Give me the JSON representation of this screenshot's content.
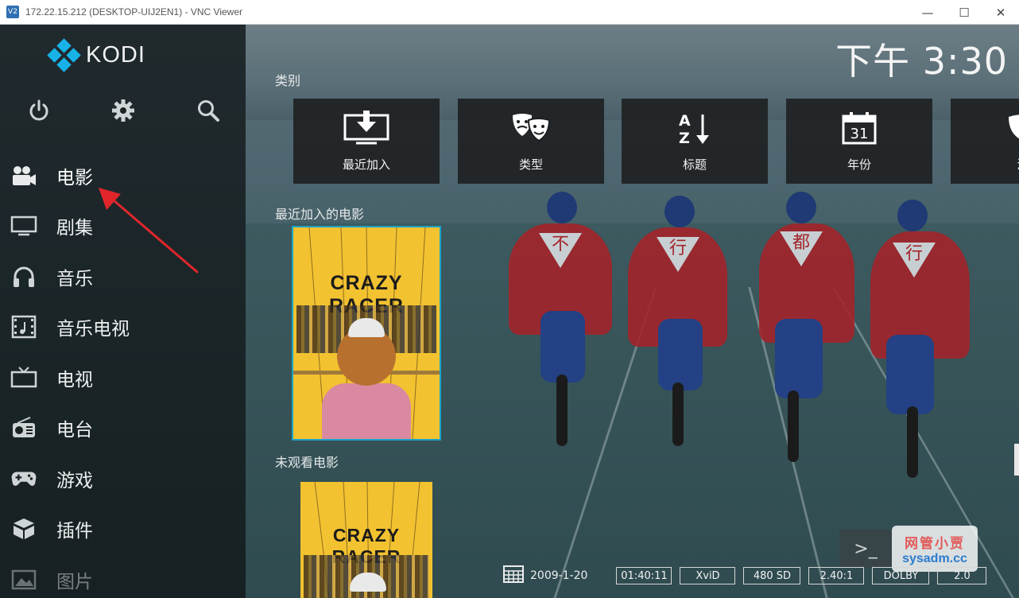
{
  "window": {
    "title": "172.22.15.212 (DESKTOP-UIJ2EN1) - VNC Viewer",
    "app_icon": "V2",
    "minimize": "—",
    "maximize": "☐",
    "close": "✕"
  },
  "kodi": {
    "logo_text": "KODI",
    "clock": "下午 3:30",
    "sidebar": {
      "top_icons": [
        "power-icon",
        "gear-icon",
        "search-icon"
      ],
      "items": [
        {
          "label": "电影",
          "icon": "movie-camera-icon",
          "active": true
        },
        {
          "label": "剧集",
          "icon": "monitor-icon"
        },
        {
          "label": "音乐",
          "icon": "headphones-icon"
        },
        {
          "label": "音乐电视",
          "icon": "film-music-icon"
        },
        {
          "label": "电视",
          "icon": "tv-icon"
        },
        {
          "label": "电台",
          "icon": "radio-icon"
        },
        {
          "label": "游戏",
          "icon": "gamepad-icon"
        },
        {
          "label": "插件",
          "icon": "box-icon"
        },
        {
          "label": "图片",
          "icon": "picture-icon"
        }
      ]
    },
    "categories": {
      "heading": "类别",
      "items": [
        {
          "label": "最近加入",
          "icon": "download-tv-icon"
        },
        {
          "label": "类型",
          "icon": "theater-masks-icon"
        },
        {
          "label": "标题",
          "icon": "az-sort-icon"
        },
        {
          "label": "年份",
          "icon": "calendar-icon",
          "icon_text": "31"
        },
        {
          "label": "演",
          "icon": "mask-icon"
        }
      ]
    },
    "recent_movies": {
      "heading": "最近加入的电影",
      "poster_title": "CRAZY RACER"
    },
    "unwatched_movies": {
      "heading": "未观看电影",
      "poster_title": "CRAZY RACER"
    },
    "status": {
      "date": "2009-1-20",
      "flags": [
        "01:40:11",
        "XviD",
        "480 SD",
        "2.40:1",
        "DOLBY",
        "2.0"
      ]
    },
    "background_emblems": [
      "不",
      "行",
      "都",
      "行"
    ]
  },
  "overlay": {
    "terminal_glyph": ">_",
    "watermark_line1": "网管小贾",
    "watermark_line2": "sysadm.cc",
    "arrow_color": "#e0262b"
  }
}
